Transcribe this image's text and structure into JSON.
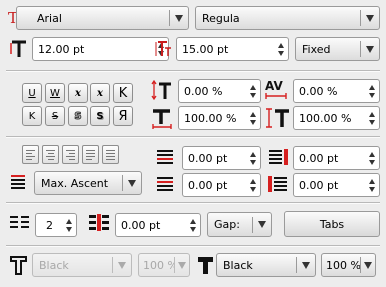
{
  "font": {
    "family": "Arial",
    "style": "Regula"
  },
  "size": {
    "font_size": "12.00 pt",
    "line_spacing": "15.00 pt",
    "spacing_mode": "Fixed"
  },
  "effects": {
    "row1": [
      "U",
      "W",
      "x",
      "x",
      "K"
    ],
    "row2": [
      "K",
      "S",
      "S",
      "S",
      "Я"
    ]
  },
  "scale": {
    "baseline_offset": "0.00 %",
    "tracking": "0.00 %",
    "horizontal_scale": "100.00 %",
    "vertical_scale": "100.00 %"
  },
  "paragraph": {
    "first_line": "Max. Ascent",
    "space_above": "0.00 pt",
    "space_above_right": "0.00 pt",
    "space_below": "0.00 pt",
    "space_below_right": "0.00 pt"
  },
  "columns": {
    "count": "2",
    "gap_value": "0.00 pt",
    "gap_label": "Gap:",
    "tabs_label": "Tabs"
  },
  "colors": {
    "stroke_color": "Black",
    "stroke_shade": "100 %",
    "fill_color": "Black",
    "fill_shade": "100 %",
    "accent_red": "#e8231c"
  }
}
